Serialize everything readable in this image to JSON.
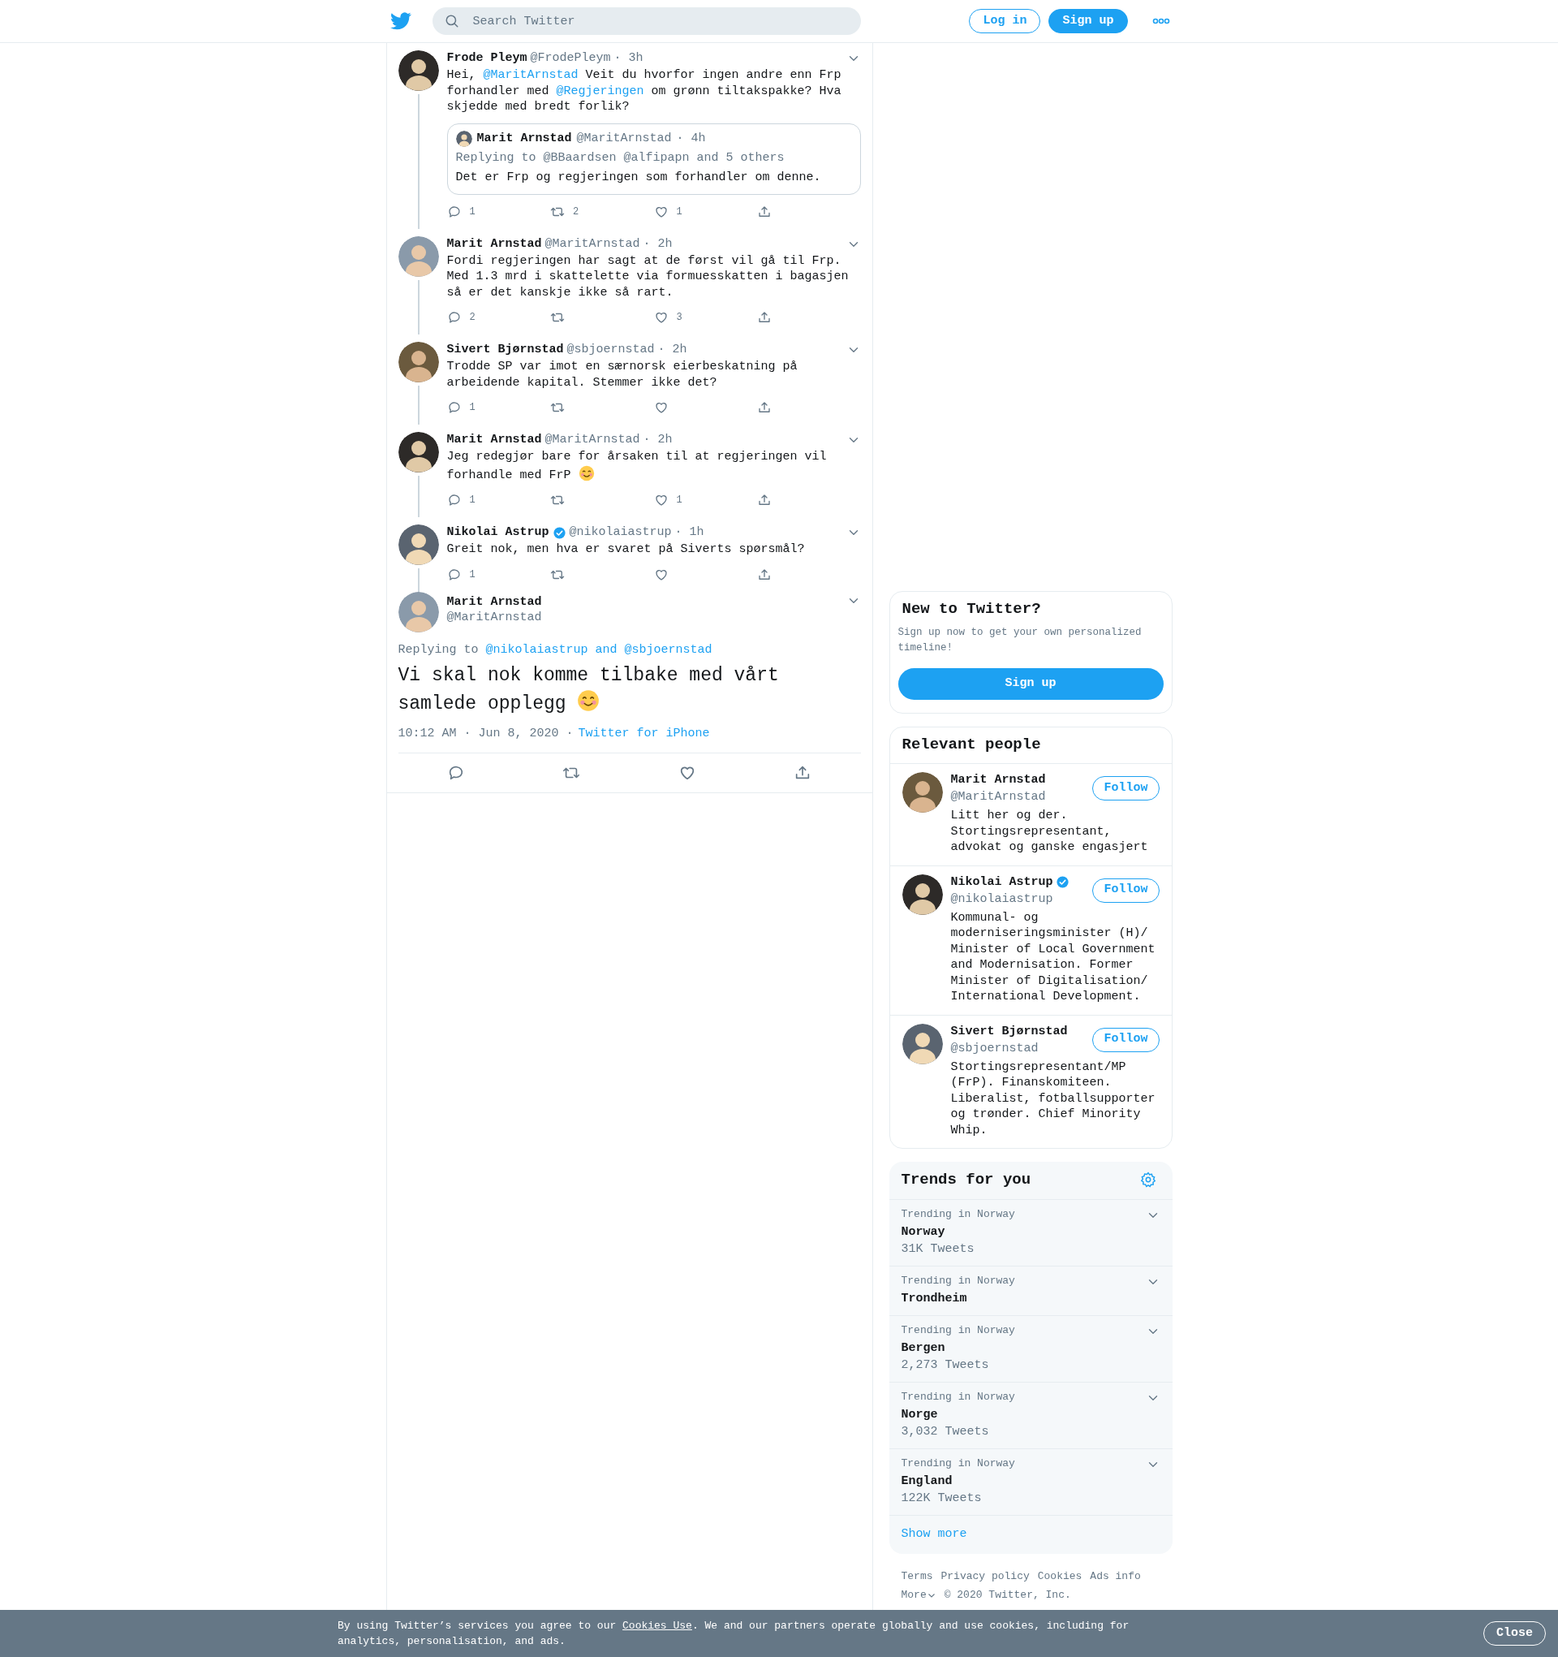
{
  "header": {
    "search": {
      "placeholder": "Search Twitter"
    },
    "buttons": [
      {
        "label": "Log in",
        "kind": "outline"
      },
      {
        "label": "Sign up",
        "kind": "filled"
      }
    ]
  },
  "thread": [
    {
      "name": "Frode Pleym",
      "handle": "@FrodePleym",
      "time": "· 3h",
      "verified": false,
      "text": [
        {
          "kind": "text",
          "text": "Hei, "
        },
        {
          "kind": "link",
          "text": "@MaritArnstad"
        },
        {
          "kind": "text",
          "text": " Veit du hvorfor ingen andre enn Frp forhandler med "
        },
        {
          "kind": "link",
          "text": "@Regjeringen"
        },
        {
          "kind": "text",
          "text": " om grønn tiltakspakke? Hva skjedde med bredt forlik?"
        }
      ],
      "quote": {
        "name": "Marit Arnstad",
        "handle": "@MaritArnstad",
        "time": "· 4h",
        "replying": "Replying to @BBaardsen @alfipapn and 5 others",
        "text": "Det er Frp og regjeringen som forhandler om denne."
      },
      "replies": "1",
      "retweets": "2",
      "likes": "1"
    },
    {
      "name": "Marit Arnstad",
      "handle": "@MaritArnstad",
      "time": "· 2h",
      "verified": false,
      "text": [
        {
          "kind": "text",
          "text": "Fordi regjeringen har sagt at de først vil gå til Frp. Med 1.3 mrd i skattelette via formuesskatten i bagasjen så er det kanskje ikke så rart."
        }
      ],
      "replies": "2",
      "likes": "3"
    },
    {
      "name": "Sivert Bjørnstad",
      "handle": "@sbjoernstad",
      "time": "· 2h",
      "verified": false,
      "text": [
        {
          "kind": "text",
          "text": "Trodde SP var imot en særnorsk eierbeskatning på arbeidende kapital. Stemmer ikke det?"
        }
      ],
      "replies": "1"
    },
    {
      "name": "Marit Arnstad",
      "handle": "@MaritArnstad",
      "time": "· 2h",
      "verified": false,
      "text": [
        {
          "kind": "text",
          "text": "Jeg redegjør bare for årsaken til at regjeringen vil forhandle med FrP "
        },
        {
          "kind": "emoji"
        }
      ],
      "replies": "1",
      "likes": "1"
    },
    {
      "name": "Nikolai Astrup",
      "handle": "@nikolaiastrup",
      "time": "· 1h",
      "verified": true,
      "text": [
        {
          "kind": "text",
          "text": "Greit nok, men hva er svaret på Siverts spørsmål?"
        }
      ],
      "replies": "1"
    }
  ],
  "main_tweet": {
    "name": "Marit Arnstad",
    "handle": "@MaritArnstad",
    "replying": [
      {
        "kind": "text",
        "text": "Replying to "
      },
      {
        "kind": "link",
        "text": "@nikolaiastrup and @sbjoernstad"
      }
    ],
    "text": [
      {
        "kind": "text",
        "text": "Vi skal nok komme tilbake med vårt samlede opplegg "
      },
      {
        "kind": "emoji"
      }
    ],
    "timestamp": "10:12 AM · Jun 8, 2020 ·",
    "source": "Twitter for iPhone"
  },
  "signup_card": {
    "title": "New to Twitter?",
    "text": "Sign up now to get your own personalized timeline!",
    "button": "Sign up"
  },
  "people_card": {
    "title": "Relevant people",
    "people": [
      {
        "name": "Marit Arnstad",
        "handle": "@MaritArnstad",
        "verified": false,
        "bio": "Litt her og der. Stortingsrepresentant, advokat og ganske engasjert",
        "button": "Follow"
      },
      {
        "name": "Nikolai Astrup",
        "handle": "@nikolaiastrup",
        "verified": true,
        "bio": "Kommunal- og moderniseringsminister (H)/ Minister of Local Government and Modernisation. Former Minister of Digitalisation/ International Development.",
        "button": "Follow"
      },
      {
        "name": "Sivert Bjørnstad",
        "handle": "@sbjoernstad",
        "verified": false,
        "bio": "Stortingsrepresentant/MP (FrP). Finanskomiteen. Liberalist, fotballsupporter og trønder. Chief Minority Whip.",
        "button": "Follow"
      }
    ]
  },
  "trends": {
    "title": "Trends for you",
    "items": [
      {
        "context": "Trending in Norway",
        "name": "Norway",
        "count": "31K Tweets"
      },
      {
        "context": "Trending in Norway",
        "name": "Trondheim"
      },
      {
        "context": "Trending in Norway",
        "name": "Bergen",
        "count": "2,273 Tweets"
      },
      {
        "context": "Trending in Norway",
        "name": "Norge",
        "count": "3,032 Tweets"
      },
      {
        "context": "Trending in Norway",
        "name": "England",
        "count": "122K Tweets"
      }
    ],
    "show_more": "Show more"
  },
  "footer": {
    "links": [
      "Terms",
      "Privacy policy",
      "Cookies",
      "Ads info"
    ],
    "more": "More",
    "copyright": "© 2020 Twitter, Inc."
  },
  "cookie_bar": {
    "text": [
      {
        "kind": "text",
        "text": "By using Twitter’s services you agree to our "
      },
      {
        "kind": "link",
        "text": "Cookies Use"
      },
      {
        "kind": "text",
        "text": ". We and our partners operate globally and use cookies, including for analytics, personalisation, and ads."
      }
    ],
    "button": "Close"
  }
}
